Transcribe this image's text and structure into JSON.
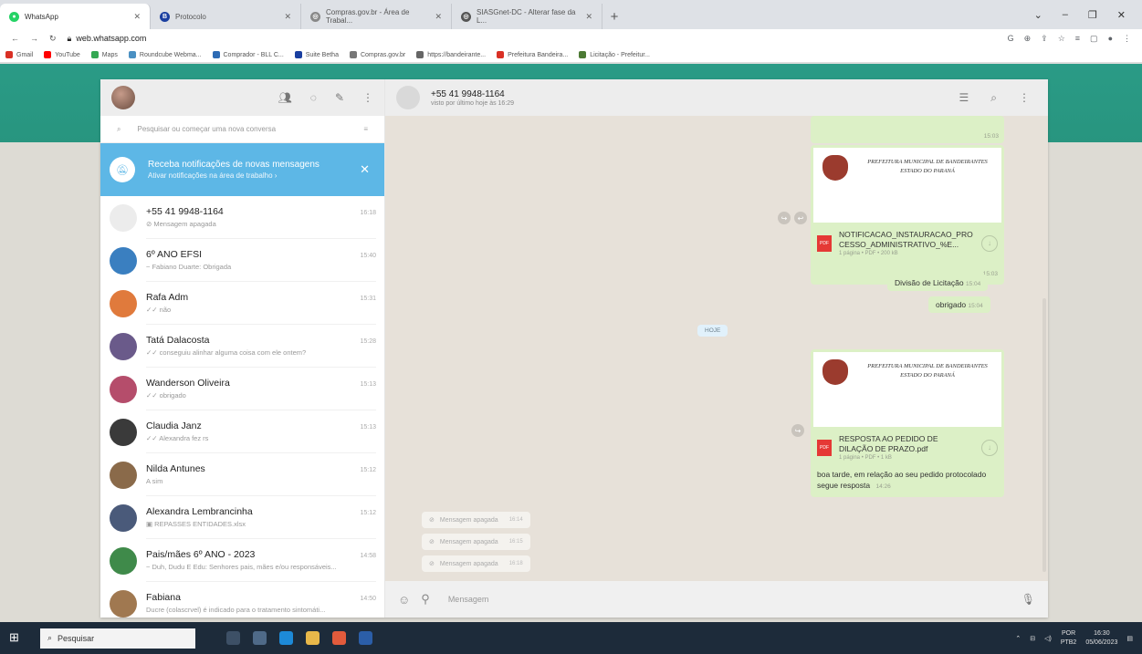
{
  "browser": {
    "tabs": [
      {
        "label": "WhatsApp",
        "icon": "whatsapp-icon",
        "color": "#25d366",
        "glyph": "●"
      },
      {
        "label": "Protocolo",
        "icon": "b-icon",
        "color": "#1a3fa0",
        "glyph": "B"
      },
      {
        "label": "Compras.gov.br - Área de Trabal...",
        "icon": "compras-icon",
        "color": "#888888",
        "glyph": "◎"
      },
      {
        "label": "SIASGnet-DC - Alterar fase da L...",
        "icon": "siasg-icon",
        "color": "#555555",
        "glyph": "◎"
      }
    ],
    "url": "web.whatsapp.com",
    "bookmarks": [
      {
        "label": "Gmail",
        "color": "#d93025"
      },
      {
        "label": "YouTube",
        "color": "#ff0000"
      },
      {
        "label": "Maps",
        "color": "#34a853"
      },
      {
        "label": "Roundcube Webma...",
        "color": "#4a90c2"
      },
      {
        "label": "Comprador - BLL C...",
        "color": "#2d6bb4"
      },
      {
        "label": "Suite Betha",
        "color": "#1a3fa0"
      },
      {
        "label": "Compras.gov.br",
        "color": "#777777"
      },
      {
        "label": "https://bandeirante...",
        "color": "#666666"
      },
      {
        "label": "Prefeitura Bandeira...",
        "color": "#d93025"
      },
      {
        "label": "Licitação - Prefeitur...",
        "color": "#4c7a34"
      }
    ]
  },
  "sidebar": {
    "search_placeholder": "Pesquisar ou começar uma nova conversa",
    "notification": {
      "title": "Receba notificações de novas mensagens",
      "subtitle": "Ativar notificações na área de trabalho ›"
    },
    "chats": [
      {
        "name": "+55 41 9948-1164",
        "preview": "⊘ Mensagem apagada",
        "time": "16:18",
        "color": "#e8e8e8"
      },
      {
        "name": "6º ANO EFSI",
        "preview": "~ Fabiano Duarte: Obrigada",
        "time": "15:40",
        "color": "#3a7fc0"
      },
      {
        "name": "Rafa Adm",
        "preview": "✓✓ não",
        "time": "15:31",
        "color": "#e07a3c"
      },
      {
        "name": "Tatá Dalacosta",
        "preview": "✓✓ conseguiu alinhar alguma coisa com ele ontem?",
        "time": "15:28",
        "color": "#6a5a8a"
      },
      {
        "name": "Wanderson Oliveira",
        "preview": "✓✓ obrigado",
        "time": "15:13",
        "color": "#b54d6b"
      },
      {
        "name": "Claudia Janz",
        "preview": "✓✓ Alexandra fez rs",
        "time": "15:13",
        "color": "#3a3a3a"
      },
      {
        "name": "Nilda Antunes",
        "preview": "A sim",
        "time": "15:12",
        "color": "#8a6a4a"
      },
      {
        "name": "Alexandra Lembrancinha",
        "preview": "▣ REPASSES ENTIDADES.xlsx",
        "time": "15:12",
        "color": "#4a5a7a"
      },
      {
        "name": "Pais/mães 6º ANO - 2023",
        "preview": "~ Duh, Dudu E Edu: Senhores pais, mães e/ou responsáveis...",
        "time": "14:58",
        "color": "#3f8a4a"
      },
      {
        "name": "Fabiana",
        "preview": "Ducre (colascrvel) é indicado para o tratamento sintomáti...",
        "time": "14:50",
        "color": "#a07850"
      }
    ]
  },
  "conversation": {
    "contact": "+55 41 9948-1164",
    "status": "visto por último hoje às 16:29",
    "doc1": {
      "header_line1": "PREFEITURA MUNICIPAL DE BANDEIRANTES",
      "header_line2": "ESTADO DO PARANÁ",
      "filename": "NOTIFICACAO_INSTAURACAO_PROCESSO_ADMINISTRATIVO_%E...",
      "meta": "1 página • PDF • 200 kB",
      "time": "15:03"
    },
    "top_time": "15:03",
    "msg_divisao": {
      "text": "Divisão de Licitação",
      "time": "15:04"
    },
    "msg_obrigado": {
      "text": "obrigado",
      "time": "15:04"
    },
    "date_divider": "HOJE",
    "doc2": {
      "header_line1": "PREFEITURA MUNICIPAL DE BANDEIRANTES",
      "header_line2": "ESTADO DO PARANÁ",
      "filename": "RESPOSTA AO PEDIDO DE DILAÇÃO DE PRAZO.pdf",
      "meta": "1 página • PDF • 1 kB"
    },
    "msg_boa_tarde": {
      "text": "boa tarde, em relação ao seu pedido protocolado segue resposta",
      "time": "14:26"
    },
    "deleted": [
      {
        "text": "Mensagem apagada",
        "time": "16:14"
      },
      {
        "text": "Mensagem apagada",
        "time": "16:15"
      },
      {
        "text": "Mensagem apagada",
        "time": "16:18"
      }
    ],
    "composer_placeholder": "Mensagem"
  },
  "taskbar": {
    "search": "Pesquisar",
    "lang1": "POR",
    "lang2": "PTB2",
    "time": "16:30",
    "date": "05/06/2023"
  }
}
